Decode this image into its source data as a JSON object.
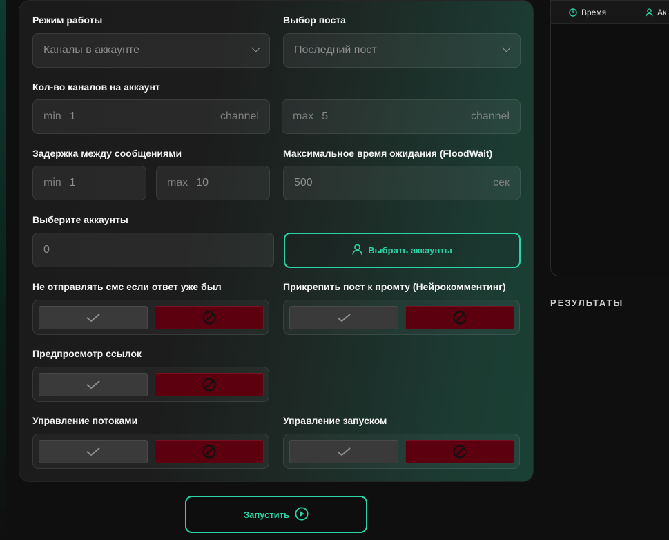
{
  "form": {
    "mode": {
      "label": "Режим работы",
      "value": "Каналы в аккаунте"
    },
    "post": {
      "label": "Выбор поста",
      "value": "Последний пост"
    },
    "channels": {
      "label": "Кол-во каналов на аккаунт",
      "min_prefix": "min",
      "min_value": "1",
      "min_suffix": "channel",
      "max_prefix": "max",
      "max_value": "5",
      "max_suffix": "channel"
    },
    "delay": {
      "label": "Задержка между сообщениями",
      "min_prefix": "min",
      "min_value": "1",
      "max_prefix": "max",
      "max_value": "10"
    },
    "floodwait": {
      "label": "Максимальное время ожидания (FloodWait)",
      "value": "500",
      "suffix": "сек"
    },
    "accounts": {
      "label": "Выберите аккаунты",
      "value": "0",
      "button_label": "Выбрать аккаунты"
    },
    "toggles": [
      {
        "key": "no_sms",
        "label": "Не отправлять смс если ответ уже был"
      },
      {
        "key": "attach_post",
        "label": "Прикрепить пост к промту (Нейрокомментинг)"
      },
      {
        "key": "link_preview",
        "label": "Предпросмотр ссылок"
      },
      {
        "key": "threads",
        "label": "Управление потоками"
      },
      {
        "key": "launch_control",
        "label": "Управление запуском"
      }
    ]
  },
  "run_button": {
    "label": "Запустить"
  },
  "log_table": {
    "columns": [
      "Время",
      "Ак"
    ]
  },
  "results": {
    "title": "РЕЗУЛЬТАТЫ"
  },
  "colors": {
    "accent": "#2bd3a5",
    "deny": "#5c0010",
    "panel_bg": "#1b1b1b"
  },
  "icons": {
    "check": "check-icon",
    "deny": "block-icon",
    "user": "user-icon",
    "play": "play-icon",
    "clock": "clock-icon"
  }
}
